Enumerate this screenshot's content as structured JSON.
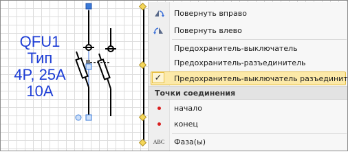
{
  "label": {
    "lines": [
      "QFU1",
      "Тип",
      "4P, 25A",
      "10A"
    ],
    "color": "#1f3fd6"
  },
  "menu": {
    "items": [
      {
        "label": "Повернуть вправо",
        "icon": "rotate-right-icon"
      },
      {
        "label": "Повернуть влево",
        "icon": "rotate-left-icon"
      },
      {
        "label": "Предохранитель-выключатель"
      },
      {
        "label": "Предохранитель-разъединитель"
      },
      {
        "label": "Предохранитель-выключатель разъединитель",
        "checked": true,
        "check_glyph": "✓"
      }
    ],
    "section_header": "Точки соединения",
    "connection_points": [
      {
        "label": "начало",
        "icon": "red-dot-icon"
      },
      {
        "label": "конец",
        "icon": "red-dot-icon"
      }
    ],
    "phases": {
      "label": "Фаза(ы)",
      "icon_text": "АВС",
      "icon": "abc-text-icon"
    },
    "highlight_color": "#fce9a8"
  }
}
